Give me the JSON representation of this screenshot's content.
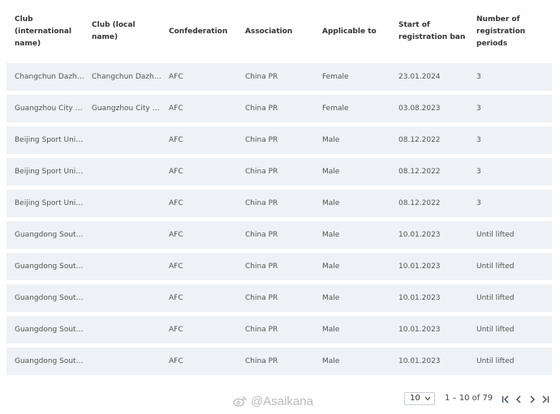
{
  "table": {
    "headers": [
      "Club\n(international\nname)",
      "Club (local\nname)",
      "Confederation",
      "Association",
      "Applicable to",
      "Start of\nregistration ban",
      "Number of\nregistration\nperiods"
    ],
    "rows": [
      [
        "Changchun Dazhong Zhuoyue",
        "Changchun Dazhong Zhuoyue",
        "AFC",
        "China PR",
        "Female",
        "23.01.2024",
        "3"
      ],
      [
        "Guangzhou City Women",
        "Guangzhou City Women",
        "AFC",
        "China PR",
        "Female",
        "03.08.2023",
        "3"
      ],
      [
        "Beijing Sport University",
        "",
        "AFC",
        "China PR",
        "Male",
        "08.12.2022",
        "3"
      ],
      [
        "Beijing Sport University",
        "",
        "AFC",
        "China PR",
        "Male",
        "08.12.2022",
        "3"
      ],
      [
        "Beijing Sport University",
        "",
        "AFC",
        "China PR",
        "Male",
        "08.12.2022",
        "3"
      ],
      [
        "Guangdong South China Tiger",
        "",
        "AFC",
        "China PR",
        "Male",
        "10.01.2023",
        "Until lifted"
      ],
      [
        "Guangdong South China Tiger",
        "",
        "AFC",
        "China PR",
        "Male",
        "10.01.2023",
        "Until lifted"
      ],
      [
        "Guangdong South China Tiger",
        "",
        "AFC",
        "China PR",
        "Male",
        "10.01.2023",
        "Until lifted"
      ],
      [
        "Guangdong South China Tiger",
        "",
        "AFC",
        "China PR",
        "Male",
        "10.01.2023",
        "Until lifted"
      ],
      [
        "Guangdong South China Tiger",
        "",
        "AFC",
        "China PR",
        "Male",
        "10.01.2023",
        "Until lifted"
      ]
    ]
  },
  "pagination": {
    "page_size": "10",
    "range_text": "1 – 10 of 79"
  },
  "watermark": {
    "text": "@Asaikana",
    "icon": "weibo-icon"
  },
  "colors": {
    "row_bg": "#eef1f5",
    "header_text": "#333333",
    "cell_text": "#555555"
  }
}
